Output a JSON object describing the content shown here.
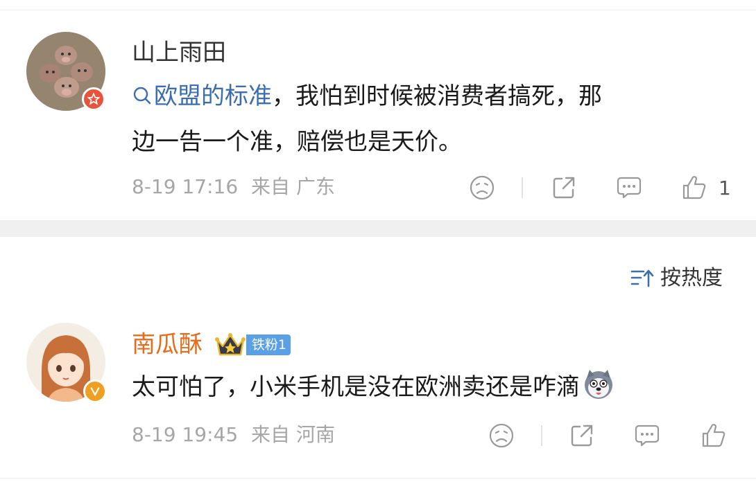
{
  "colors": {
    "link": "#3b6db0",
    "username_normal": "#333333",
    "username_vip": "#e86b1a",
    "meta_gray": "#a6a6a6",
    "fan_tag_bg": "#5aa0e6",
    "badge_red": "#e8533b",
    "badge_orange": "#f0a020"
  },
  "comments": [
    {
      "username": "山上雨田",
      "topic_link": "欧盟的标准",
      "text_line1_rest": "，我怕到时候被消费者搞死，那",
      "text_line2": "边一告一个准，赔偿也是天价。",
      "date": "8-19 17:16",
      "source": "来自 广东",
      "like_count": "1",
      "avatar_icon": "pig-photo-avatar",
      "badge_icon": "red-star-badge"
    },
    {
      "username": "南瓜酥",
      "fan_tag": "铁粉1",
      "text": "太可怕了，小米手机是没在欧洲卖还是咋滴",
      "emoji_icon": "husky-dog-emoji",
      "date": "8-19 19:45",
      "source": "来自 河南",
      "avatar_icon": "anime-girl-avatar",
      "badge_icon": "orange-v-badge"
    }
  ],
  "sort": {
    "label": "按热度",
    "icon": "sort-icon"
  },
  "actions": [
    "dislike-icon",
    "share-icon",
    "comment-icon",
    "like-icon"
  ]
}
